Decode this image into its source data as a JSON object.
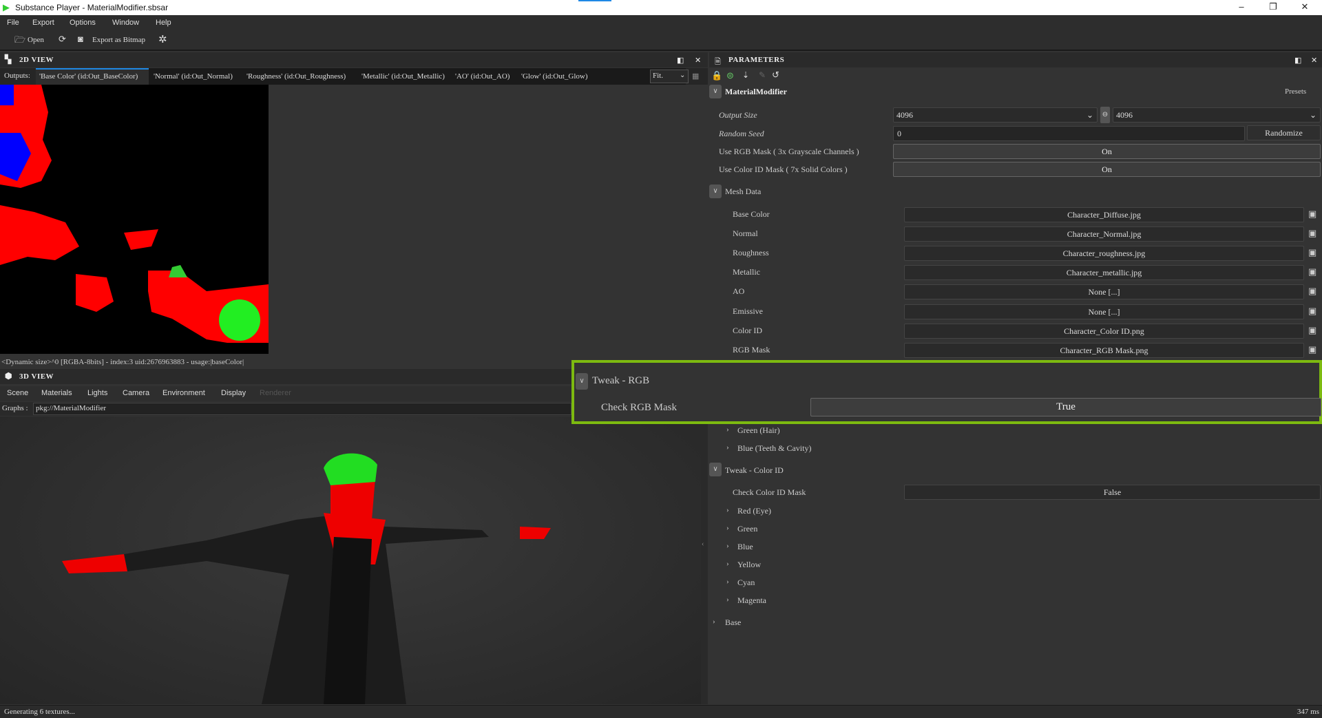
{
  "window": {
    "title": "Substance Player - MaterialModifier.sbsar",
    "minimize": "–",
    "restore": "❐",
    "close": "✕"
  },
  "menu": [
    "File",
    "Export",
    "Options",
    "Window",
    "Help"
  ],
  "toolbar": {
    "open": "Open",
    "export": "Export as Bitmap"
  },
  "view2d": {
    "title": "2D VIEW",
    "outputs_label": "Outputs:",
    "tabs": [
      "'Base Color' (id:Out_BaseColor)",
      "'Normal' (id:Out_Normal)",
      "'Roughness' (id:Out_Roughness)",
      "'Metallic' (id:Out_Metallic)",
      "'AO' (id:Out_AO)",
      "'Glow' (id:Out_Glow)"
    ],
    "zoom": "Fit.",
    "status": "<Dynamic size>^0 [RGBA-8bits] - index:3 uid:2676963883 - usage:|baseColor|"
  },
  "view3d": {
    "title": "3D VIEW",
    "menu": [
      "Scene",
      "Materials",
      "Lights",
      "Camera",
      "Environment",
      "Display",
      "Renderer"
    ],
    "graphs_label": "Graphs :",
    "graph": "pkg://MaterialModifier"
  },
  "params": {
    "title": "PARAMETERS",
    "root": "MaterialModifier",
    "presets": "Presets",
    "output_size": {
      "label": "Output Size",
      "w": "4096",
      "h": "4096"
    },
    "random_seed": {
      "label": "Random Seed",
      "value": "0",
      "button": "Randomize"
    },
    "use_rgb": {
      "label": "Use RGB Mask ( 3x Grayscale Channels )",
      "value": "On"
    },
    "use_colorid": {
      "label": "Use Color ID Mask ( 7x Solid Colors )",
      "value": "On"
    },
    "mesh_data": {
      "label": "Mesh Data",
      "rows": [
        {
          "label": "Base Color",
          "value": "Character_Diffuse.jpg"
        },
        {
          "label": "Normal",
          "value": "Character_Normal.jpg"
        },
        {
          "label": "Roughness",
          "value": "Character_roughness.jpg"
        },
        {
          "label": "Metallic",
          "value": "Character_metallic.jpg"
        },
        {
          "label": "AO",
          "value": "None [...]"
        },
        {
          "label": "Emissive",
          "value": "None [...]"
        },
        {
          "label": "Color ID",
          "value": "Character_Color ID.png"
        },
        {
          "label": "RGB Mask",
          "value": "Character_RGB Mask.png"
        }
      ]
    },
    "tweak_rgb": {
      "label": "Tweak - RGB",
      "check_label": "Check RGB Mask",
      "check_value": "True",
      "subs": [
        "Green (Hair)",
        "Blue (Teeth & Cavity)"
      ]
    },
    "tweak_colorid": {
      "label": "Tweak - Color ID",
      "check_label": "Check Color ID Mask",
      "check_value": "False",
      "subs": [
        "Red (Eye)",
        "Green",
        "Blue",
        "Yellow",
        "Cyan",
        "Magenta"
      ]
    },
    "base": "Base"
  },
  "statusbar": {
    "left": "Generating 6 textures...",
    "right": "347 ms"
  },
  "colors": {
    "highlight": "#7dba10",
    "accent": "#1e88e5"
  }
}
